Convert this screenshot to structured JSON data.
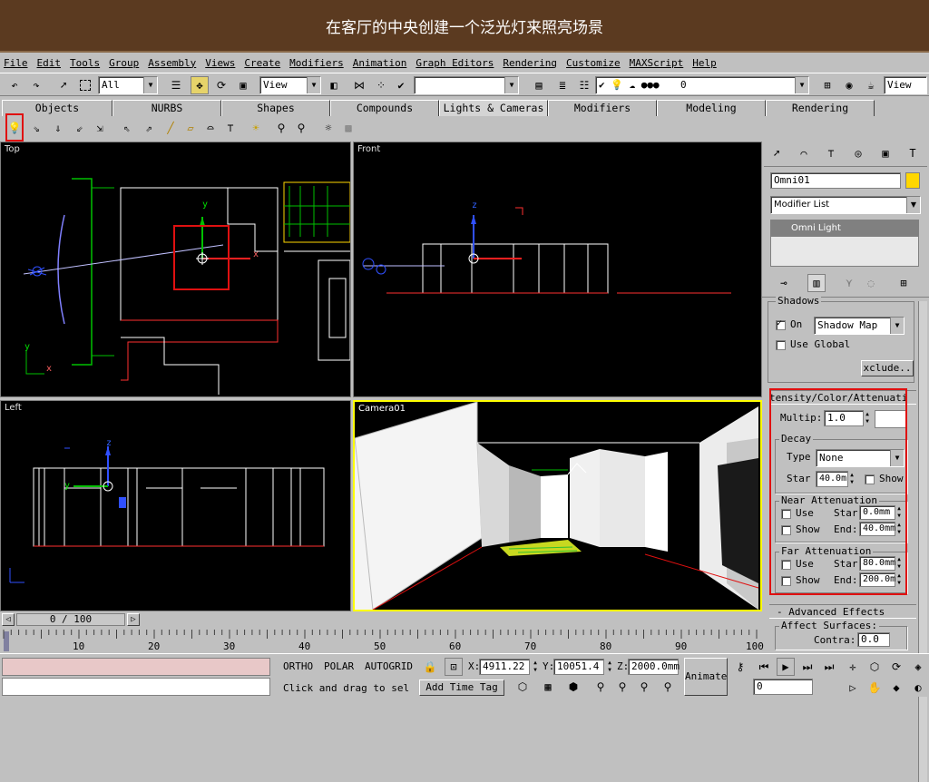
{
  "banner": {
    "title": "在客厅的中央创建一个泛光灯来照亮场景"
  },
  "menu": [
    "File",
    "Edit",
    "Tools",
    "Group",
    "Assembly",
    "Views",
    "Create",
    "Modifiers",
    "Animation",
    "Graph Editors",
    "Rendering",
    "Customize",
    "MAXScript",
    "Help"
  ],
  "toolbar": {
    "selection_filter": "All",
    "coord_system": "View",
    "named_selection": "",
    "layer": "0",
    "render_view": "View"
  },
  "tabs": [
    "Objects",
    "NURBS",
    "Shapes",
    "Compounds",
    "Lights & Cameras",
    "Modifiers",
    "Modeling",
    "Rendering"
  ],
  "viewports": {
    "top": "Top",
    "front": "Front",
    "left": "Left",
    "camera": "Camera01"
  },
  "axes": {
    "x": "x",
    "y": "y",
    "z": "z"
  },
  "cmd": {
    "object_name": "Omni01",
    "modifier_list": "Modifier List",
    "stack_item": "Omni Light",
    "shadows_rollout": "Shadows",
    "shadows_on_label": "On",
    "shadow_type": "Shadow Map",
    "use_global_label": "Use Global",
    "exclude_button": "xclude..",
    "intensity_rollout": "tensity/Color/Attenuati",
    "multiplier_label": "Multip:",
    "multiplier_value": "1.0",
    "decay_group": "Decay",
    "decay_type_label": "Type",
    "decay_type": "None",
    "decay_start_label": "Star",
    "decay_start": "40.0m",
    "decay_show_label": "Show",
    "near_group": "Near Attenuation",
    "near_use": "Use",
    "near_start_label": "Star",
    "near_start": "0.0mm",
    "near_show": "Show",
    "near_end_label": "End:",
    "near_end": "40.0mm",
    "far_group": "Far Attenuation",
    "far_use": "Use",
    "far_start_label": "Star",
    "far_start": "80.0mm",
    "far_show": "Show",
    "far_end_label": "End:",
    "far_end": "200.0m",
    "advanced_rollout": "-  Advanced Effects",
    "affect_surfaces": "Affect Surfaces:",
    "contrast_label": "Contra:",
    "contrast_value": "0.0"
  },
  "timeline": {
    "frame_counter": "0 / 100",
    "ticks": [
      "10",
      "20",
      "30",
      "40",
      "50",
      "60",
      "70",
      "80",
      "90",
      "100"
    ]
  },
  "status": {
    "ortho": "ORTHO",
    "polar": "POLAR",
    "autogrid": "AUTOGRID",
    "x_label": "X:",
    "x_value": "4911.22",
    "y_label": "Y:",
    "y_value": "10051.4",
    "z_label": "Z:",
    "z_value": "2000.0mm",
    "prompt": "Click and drag to sel",
    "add_time_tag": "Add Time Tag",
    "animate": "Animate",
    "frame_value": "0"
  },
  "colors": {
    "banner_bg": "#5b3a20",
    "highlight": "#e01010",
    "panel": "#c0c0c0",
    "active_viewport_border": "#ffff00"
  }
}
